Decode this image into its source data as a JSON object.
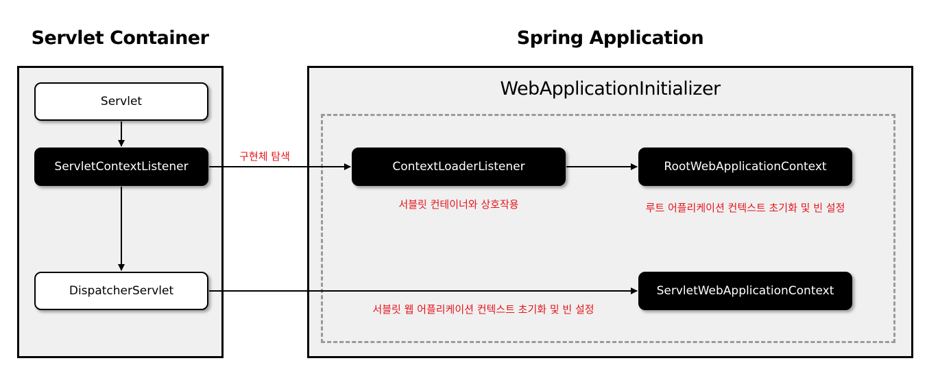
{
  "titles": {
    "servlet_container": "Servlet Container",
    "spring_application": "Spring Application",
    "initializer": "WebApplicationInitializer"
  },
  "nodes": {
    "servlet": "Servlet",
    "servlet_context_listener": "ServletContextListener",
    "dispatcher_servlet": "DispatcherServlet",
    "context_loader_listener": "ContextLoaderListener",
    "root_web_application_context": "RootWebApplicationContext",
    "servlet_web_application_context": "ServletWebApplicationContext"
  },
  "annotations": {
    "implementation_search": "구현체 탐색",
    "context_loader_listener_note": "서블릿 컨테이너와 상호작용",
    "root_context_note": "루트 어플리케이션 컨텍스트 초기화 및 빈 설정",
    "servlet_context_note": "서블릿 웹 어플리케이션 컨텍스트 초기화 및 빈 설정"
  },
  "colors": {
    "annotation": "#e4151b",
    "container_fill": "#f0f0f0",
    "dashed_border": "#9a9a9a"
  }
}
